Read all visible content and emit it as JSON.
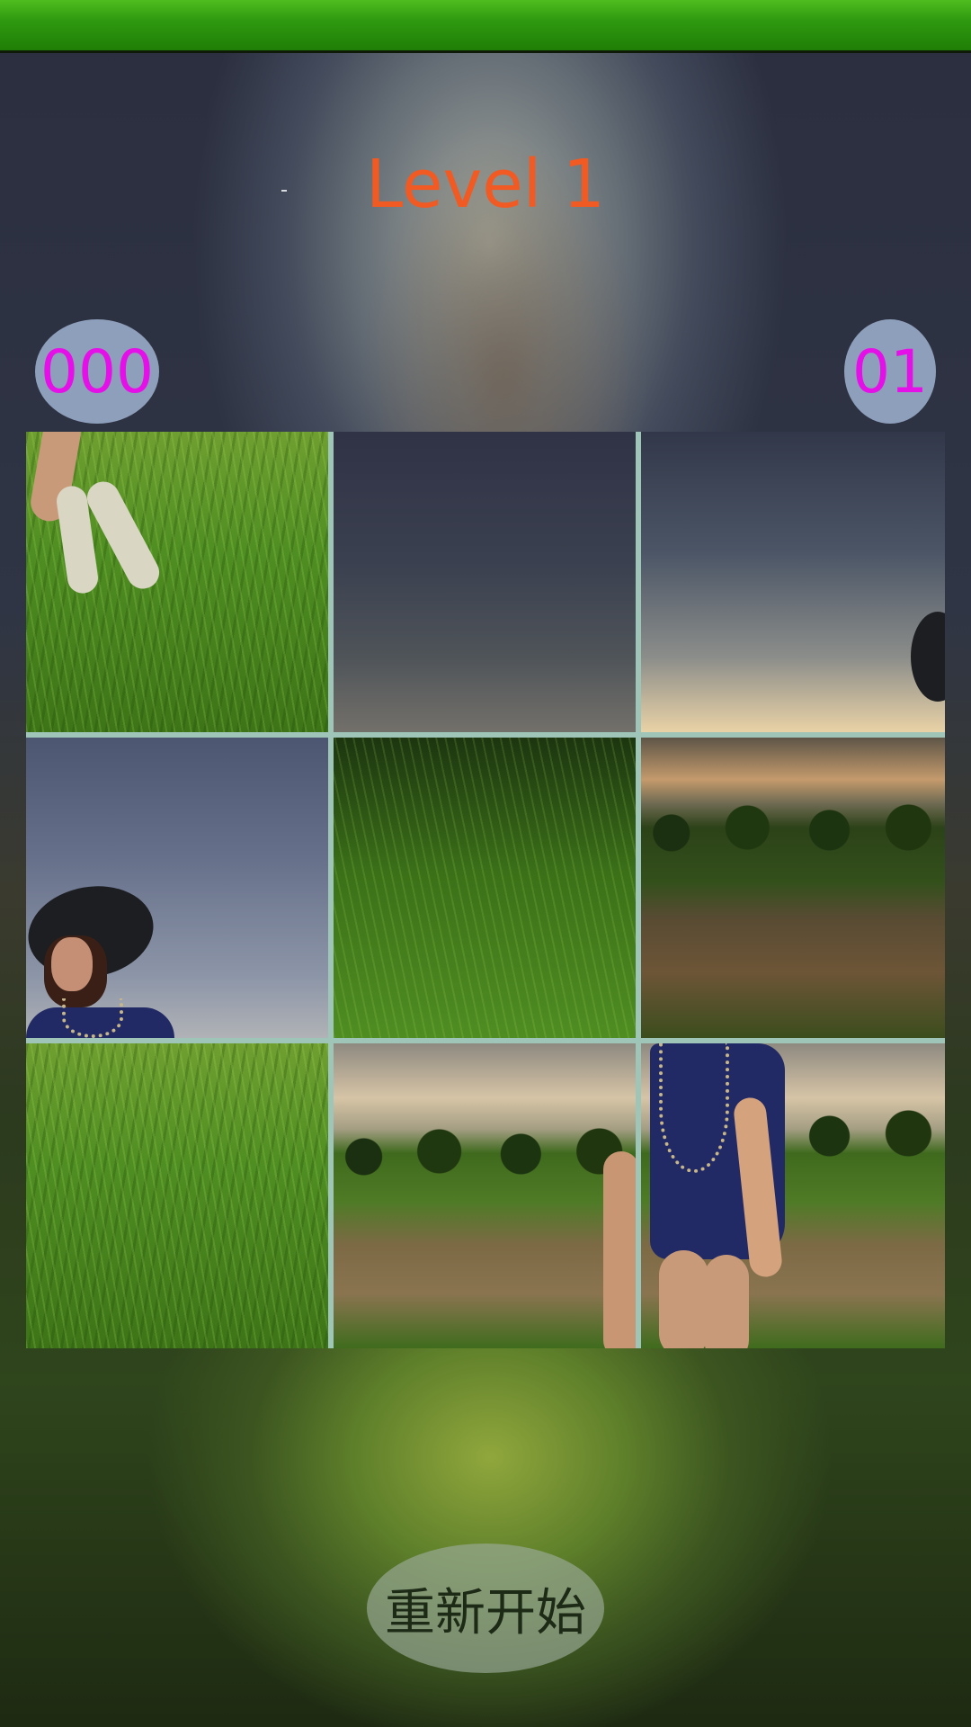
{
  "header": {
    "level_title": "Level 1"
  },
  "hud": {
    "moves": "000",
    "timer": "01"
  },
  "puzzle": {
    "grid": "3x3",
    "tiles": [
      {
        "piece": "legs-in-grass"
      },
      {
        "piece": "dark-sky"
      },
      {
        "piece": "sunset-sky-hat-edge"
      },
      {
        "piece": "woman-with-black-hat"
      },
      {
        "piece": "green-grass"
      },
      {
        "piece": "field-at-sunset"
      },
      {
        "piece": "tall-grass"
      },
      {
        "piece": "field-with-hay"
      },
      {
        "piece": "woman-blue-dress"
      }
    ]
  },
  "controls": {
    "restart_label": "重新开始"
  }
}
